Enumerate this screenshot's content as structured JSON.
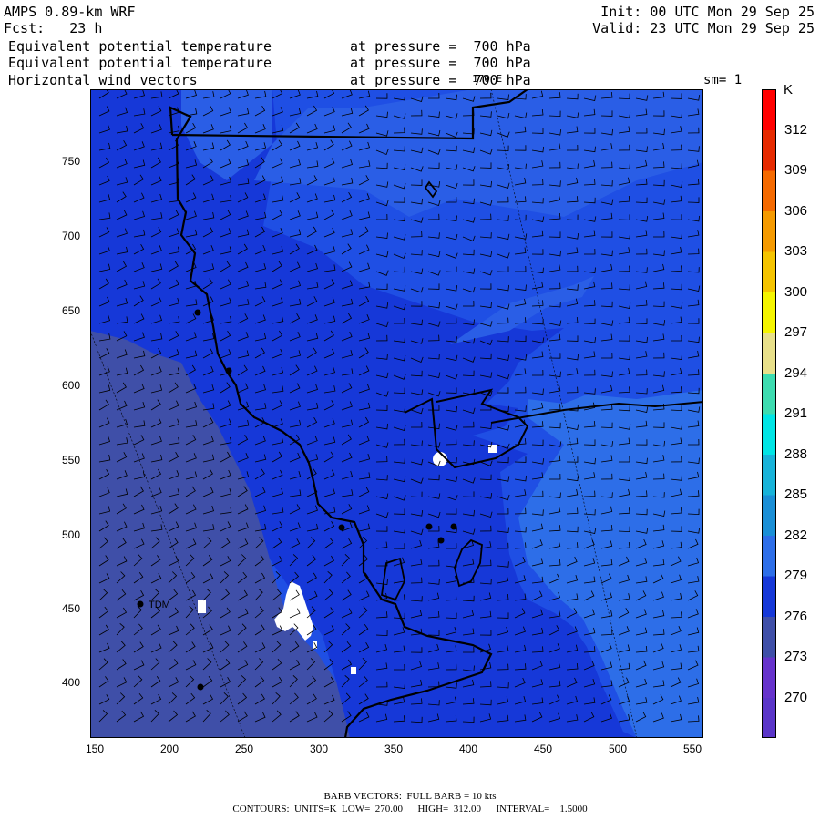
{
  "header": {
    "model": "AMPS 0.89-km WRF",
    "forecast": "Fcst:   23 h",
    "init": "Init: 00 UTC Mon 29 Sep 25",
    "valid": "Valid: 23 UTC Mon 29 Sep 25",
    "fields": [
      {
        "name": "Equivalent potential temperature",
        "level": "at pressure =  700 hPa"
      },
      {
        "name": "Equivalent potential temperature",
        "level": "at pressure =  700 hPa"
      },
      {
        "name": "Horizontal wind vectors",
        "level": "at pressure =  700 hPa"
      }
    ],
    "meridian_label": "170 E",
    "smoothing": "sm= 1"
  },
  "map": {
    "station_label": "TDM",
    "x_ticks": [
      "150",
      "200",
      "250",
      "300",
      "350",
      "400",
      "450",
      "500",
      "550"
    ],
    "y_ticks": [
      "750",
      "700",
      "650",
      "600",
      "550",
      "500",
      "450",
      "400"
    ],
    "x_range": [
      147,
      552
    ],
    "y_range": [
      362,
      792
    ],
    "fill_colors": {
      "270": "#5a35c8",
      "273": "#3f4fa8",
      "276": "#1638d8",
      "279": "#1f4fe4",
      "282": "#2d6ee8",
      "missing": "#ffffff"
    }
  },
  "colorbar": {
    "unit": "K",
    "levels": [
      "270",
      "273",
      "276",
      "279",
      "282",
      "285",
      "288",
      "291",
      "294",
      "297",
      "300",
      "303",
      "306",
      "309",
      "312"
    ],
    "colors": [
      "#5a35c8",
      "#6633cc",
      "#3f4fa8",
      "#1638d8",
      "#2d6ee8",
      "#1a8fd6",
      "#17b3d9",
      "#00e5e5",
      "#3ddcb0",
      "#e8e08a",
      "#f5f500",
      "#f5c400",
      "#f59a00",
      "#f56a00",
      "#e62a00",
      "#ff0000"
    ]
  },
  "footer": {
    "barb_line": "BARB VECTORS:  FULL BARB = 10 kts",
    "contour_line": "CONTOURS:  UNITS=K  LOW=  270.00      HIGH=  312.00      INTERVAL=    1.5000"
  }
}
